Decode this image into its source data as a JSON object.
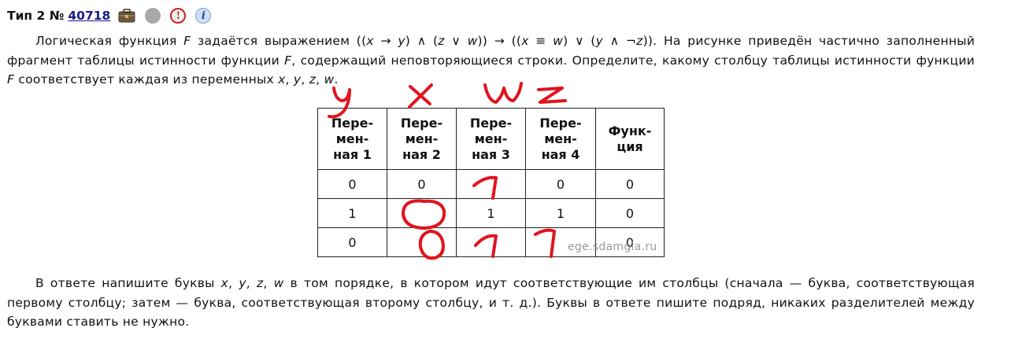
{
  "header": {
    "type_label": "Тип 2 №",
    "number": "40718",
    "icons": [
      "briefcase-icon",
      "grey-circle-icon",
      "alert-icon",
      "info-icon"
    ],
    "alert_glyph": "!",
    "info_glyph": "i"
  },
  "condition": {
    "s1": "Логическая функция ",
    "F": "F",
    "s2": " задаётся выражением ((",
    "x": "x",
    "s3": " → ",
    "y": "y",
    "s4": ") ∧ (",
    "z": "z",
    "s5": " ∨ ",
    "w": "w",
    "s6": ")) → ((",
    "x2": "x",
    "s7": " ≡ ",
    "w2": "w",
    "s8": ") ∨ (",
    "y2": "y",
    "s9": " ∧ ¬",
    "z2": "z",
    "s10": ")). На рисунке приведён частично запол­ненный фрагмент таблицы истинности функции ",
    "F2": "F",
    "s11": ", содержащий неповторяющиеся строки. Определите, какому столбцу таблицы истинности функции ",
    "F3": "F",
    "s12": " соответствует каждая из переменных ",
    "vx": "x",
    "c1": ", ",
    "vy": "y",
    "c2": ", ",
    "vz": "z",
    "c3": ", ",
    "vw": "w",
    "end": "."
  },
  "table": {
    "headers": [
      [
        "Пере-",
        "мен-",
        "ная 1"
      ],
      [
        "Пере-",
        "мен-",
        "ная 2"
      ],
      [
        "Пере-",
        "мен-",
        "ная 3"
      ],
      [
        "Пере-",
        "мен-",
        "ная 4"
      ],
      [
        "Функ-",
        "ция"
      ]
    ],
    "rows": [
      [
        "0",
        "0",
        "",
        "0",
        "0"
      ],
      [
        "1",
        "",
        "1",
        "1",
        "0"
      ],
      [
        "0",
        "",
        "",
        "",
        "0"
      ]
    ]
  },
  "watermark": "ege.sdamgia.ru",
  "answer_note": {
    "s1": "В ответе напишите буквы ",
    "x": "x",
    "c1": ", ",
    "y": "y",
    "c2": ", ",
    "z": "z",
    "c3": ", ",
    "w": "w",
    "s2": " в том порядке, в котором идут соответствующие им столбцы (сначала — буква, соответ­ствующая первому столбцу; затем — буква, соответствующая второму столбцу, и т. д.). Буквы в ответе пишите подряд, никаких разделителей между буквами ставить не нужно."
  },
  "colors": {
    "link": "#1a1a8a",
    "handwriting": "#e0141e",
    "alert": "#d21f1f",
    "watermark": "#9a9a9a"
  }
}
